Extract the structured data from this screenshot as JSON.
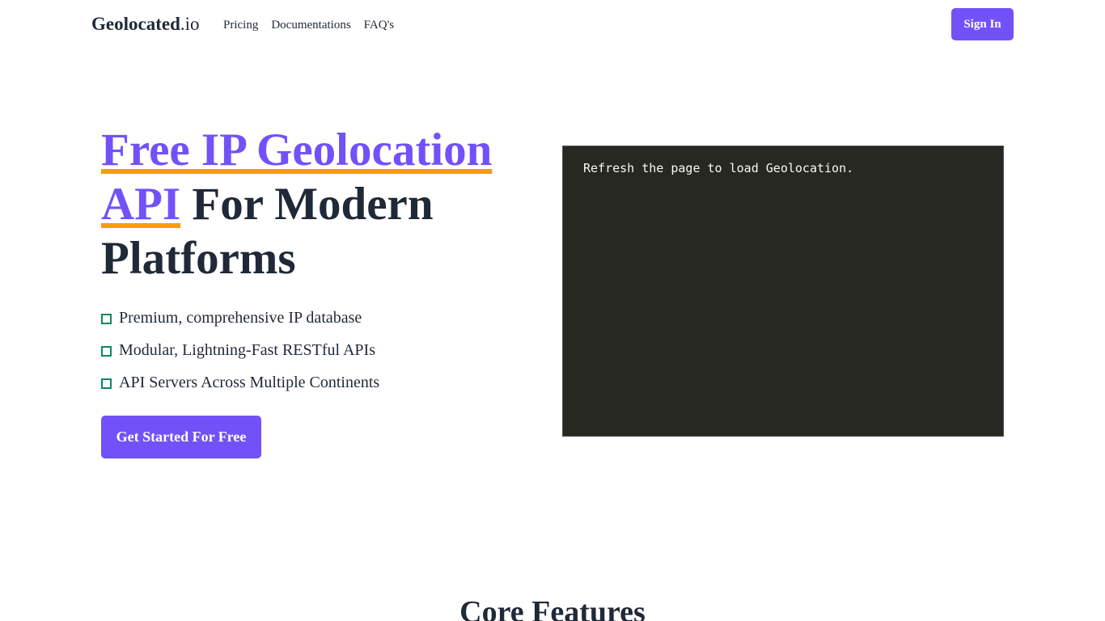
{
  "header": {
    "logo_main": "Geolocated",
    "logo_tld": ".io",
    "nav": [
      "Pricing",
      "Documentations",
      "FAQ's"
    ],
    "signin_label": "Sign In"
  },
  "hero": {
    "title_accent_1": "Free IP Geolocation",
    "title_accent_2": "API",
    "title_rest": " For Modern Platforms",
    "features": [
      "Premium, comprehensive IP database",
      "Modular, Lightning-Fast RESTful APIs",
      "API Servers Across Multiple Continents"
    ],
    "cta_label": "Get Started For Free"
  },
  "terminal": {
    "text": "Refresh the page to load Geolocation."
  },
  "section": {
    "title": "Core Features"
  },
  "colors": {
    "brand": "#7351f9",
    "underline": "#f59e0b",
    "check": "#0d8a5a",
    "terminal_bg": "#272822"
  },
  "icons": {
    "feature_bullet": "square-check-icon"
  }
}
